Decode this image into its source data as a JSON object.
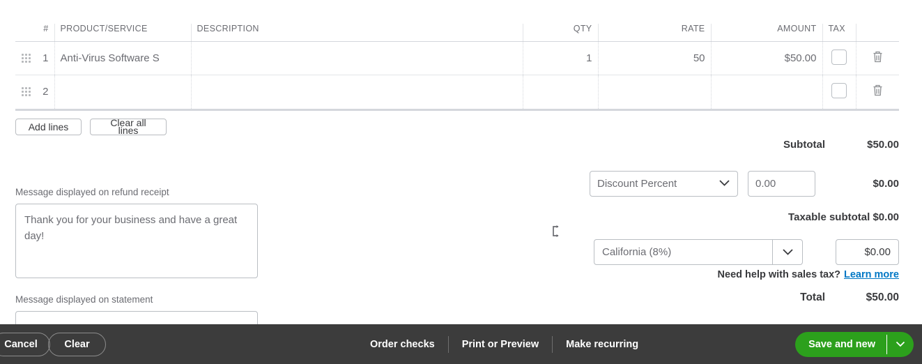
{
  "table": {
    "columns": [
      "",
      "#",
      "PRODUCT/SERVICE",
      "DESCRIPTION",
      "QTY",
      "RATE",
      "AMOUNT",
      "TAX",
      ""
    ],
    "rows": [
      {
        "num": "1",
        "product": "Anti-Virus Software S",
        "description": "",
        "qty": "1",
        "rate": "50",
        "amount": "$50.00"
      },
      {
        "num": "2",
        "product": "",
        "description": "",
        "qty": "",
        "rate": "",
        "amount": ""
      }
    ]
  },
  "line_actions": {
    "add_lines": "Add lines",
    "clear_all_lines": "Clear all lines"
  },
  "messages": {
    "refund_label": "Message displayed on refund receipt",
    "refund_value": "Thank you for your business and have a great day!",
    "statement_label": "Message displayed on statement",
    "statement_value": ""
  },
  "totals": {
    "subtotal_label": "Subtotal",
    "subtotal_value": "$50.00",
    "discount_type": "Discount Percent",
    "discount_input": "0.00",
    "discount_value": "$0.00",
    "taxable_subtotal": "Taxable subtotal $0.00",
    "tax_rate": "California (8%)",
    "tax_amount": "$0.00",
    "help_text": "Need help with sales tax?",
    "help_link": "Learn more",
    "total_label": "Total",
    "total_value": "$50.00"
  },
  "bottom_bar": {
    "cancel": "Cancel",
    "clear": "Clear",
    "order_checks": "Order checks",
    "print_or_preview": "Print or Preview",
    "make_recurring": "Make recurring",
    "save_and_new": "Save and new"
  },
  "colors": {
    "brand_green": "#2CA01C",
    "bar_dark": "#3C3C3C",
    "link_blue": "#0077C5"
  }
}
